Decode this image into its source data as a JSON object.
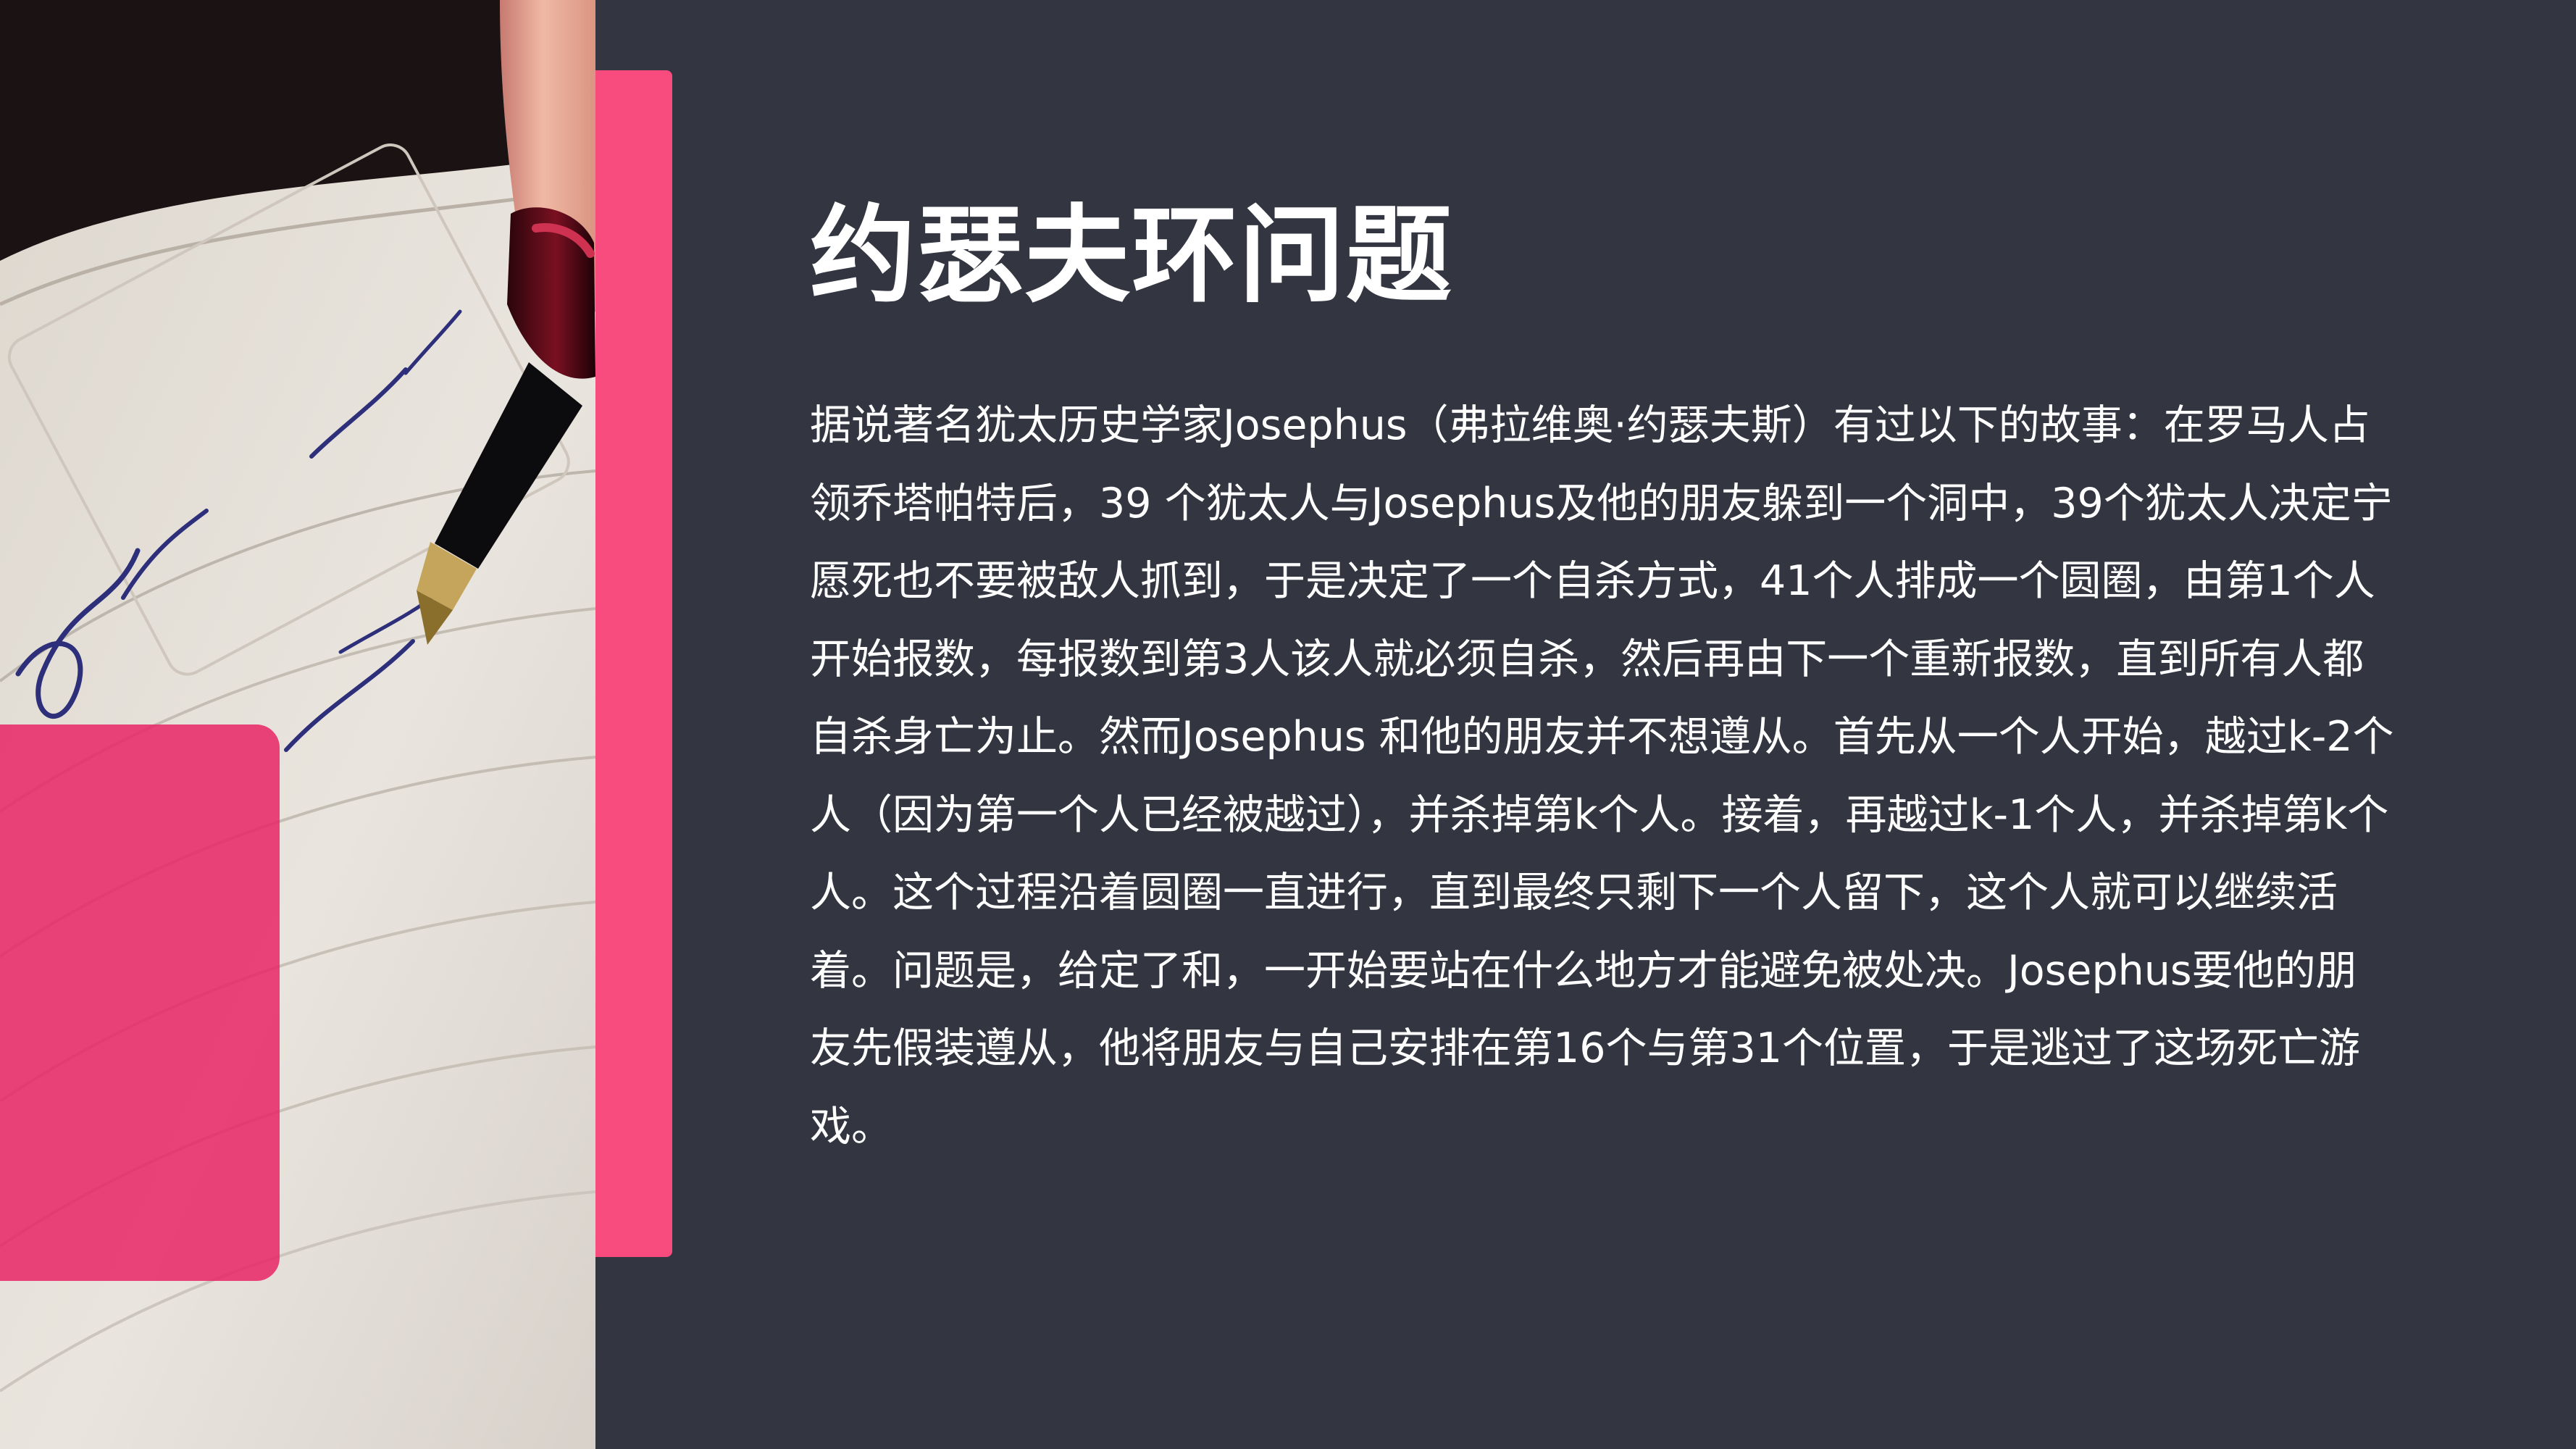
{
  "slide": {
    "title": "约瑟夫环问题",
    "body": "据说著名犹太历史学家Josephus（弗拉维奥·约瑟夫斯）有过以下的故事：在罗马人占领乔塔帕特后，39 个犹太人与Josephus及他的朋友躲到一个洞中，39个犹太人决定宁愿死也不要被敌人抓到，于是决定了一个自杀方式，41个人排成一个圆圈，由第1个人开始报数，每报数到第3人该人就必须自杀，然后再由下一个重新报数，直到所有人都自杀身亡为止。然而Josephus 和他的朋友并不想遵从。首先从一个人开始，越过k-2个人（因为第一个人已经被越过），并杀掉第k个人。接着，再越过k-1个人，并杀掉第k个人。这个过程沿着圆圈一直进行，直到最终只剩下一个人留下，这个人就可以继续活着。问题是，给定了和，一开始要站在什么地方才能避免被处决。Josephus要他的朋友先假装遵从，他将朋友与自己安排在第16个与第31个位置，于是逃过了这场死亡游戏。"
  },
  "colors": {
    "background": "#333640",
    "accent": "#f94c7e",
    "overlay": "#e82668",
    "title": "#ffffff",
    "text": "#ffffff"
  },
  "decorations": {
    "photo": "hand-writing-with-fountain-pen-photo",
    "accent_bar": "pink-vertical-bar",
    "overlay": "pink-rounded-panel"
  }
}
